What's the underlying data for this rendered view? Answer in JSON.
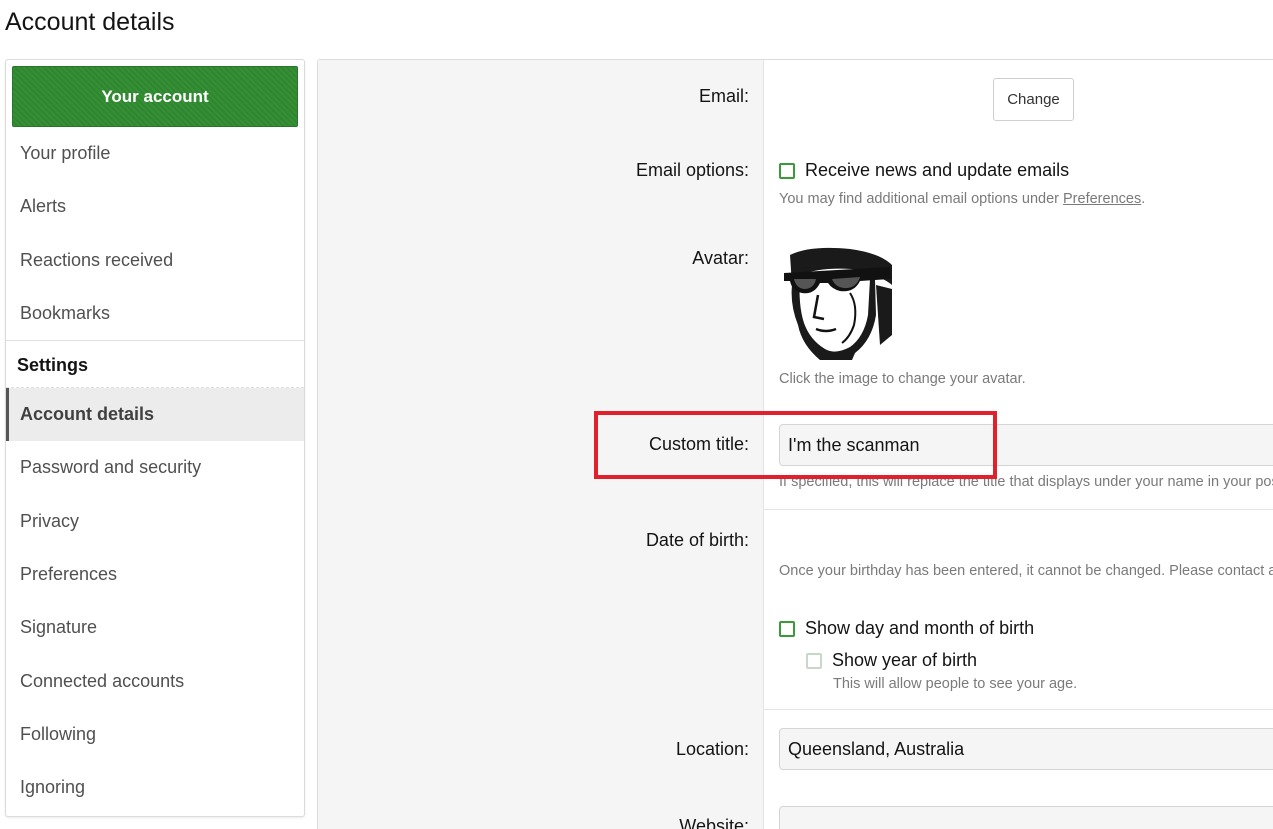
{
  "page": {
    "title": "Account details"
  },
  "sidebar": {
    "header": "Your account",
    "items_top": [
      {
        "label": "Your profile"
      },
      {
        "label": "Alerts"
      },
      {
        "label": "Reactions received"
      },
      {
        "label": "Bookmarks"
      }
    ],
    "section_label": "Settings",
    "items_settings": [
      {
        "label": "Account details",
        "active": true
      },
      {
        "label": "Password and security"
      },
      {
        "label": "Privacy"
      },
      {
        "label": "Preferences"
      },
      {
        "label": "Signature"
      },
      {
        "label": "Connected accounts"
      },
      {
        "label": "Following"
      },
      {
        "label": "Ignoring"
      }
    ]
  },
  "form": {
    "email": {
      "label": "Email:",
      "button": "Change"
    },
    "email_options": {
      "label": "Email options:",
      "checkbox": "Receive news and update emails",
      "checked": false,
      "hint_prefix": "You may find additional email options under ",
      "hint_link": "Preferences",
      "hint_suffix": "."
    },
    "avatar": {
      "label": "Avatar:",
      "hint": "Click the image to change your avatar."
    },
    "custom_title": {
      "label": "Custom title:",
      "value": "I'm the scanman",
      "hint": "If specified, this will replace the title that displays under your name in your posts."
    },
    "dob": {
      "label": "Date of birth:",
      "hint": "Once your birthday has been entered, it cannot be changed. Please contact an administrator",
      "show_day_month": "Show day and month of birth",
      "show_year": "Show year of birth",
      "show_year_hint": "This will allow people to see your age."
    },
    "location": {
      "label": "Location:",
      "value": "Queensland, Australia"
    },
    "website": {
      "label": "Website:",
      "value": ""
    }
  },
  "colors": {
    "accent": "#2f8a2f",
    "highlight": "#e0202a"
  }
}
